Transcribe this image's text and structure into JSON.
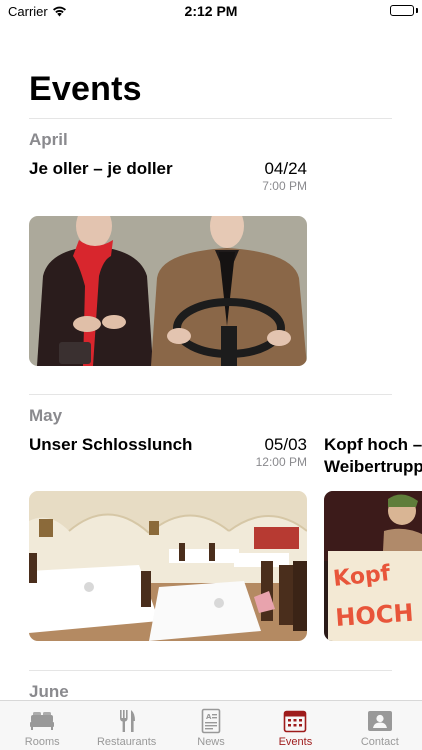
{
  "status_bar": {
    "carrier": "Carrier",
    "time": "2:12 PM",
    "battery_level": 1.0
  },
  "page": {
    "title": "Events"
  },
  "sections": [
    {
      "month": "April",
      "events": [
        {
          "title": "Je oller – je doller",
          "date": "04/24",
          "time": "7:00 PM",
          "image": "two-performers-theatre-photo"
        }
      ]
    },
    {
      "month": "May",
      "events": [
        {
          "title": "Unser Schlosslunch",
          "date": "05/03",
          "time": "12:00 PM",
          "image": "vaulted-restaurant-hall-photo"
        },
        {
          "title": "Kopf hoch – Weibertrupp",
          "title_line1": "Kopf hoch –",
          "title_line2": "Weibertrupp",
          "image": "performer-with-sign-photo",
          "sign_text_1": "Kopf",
          "sign_text_2": "HOCH"
        }
      ]
    },
    {
      "month": "June",
      "events": []
    }
  ],
  "tab_bar": {
    "active_color": "#9e1b1b",
    "inactive_color": "#999999",
    "tabs": [
      {
        "label": "Rooms",
        "icon": "bed-icon",
        "active": false
      },
      {
        "label": "Restaurants",
        "icon": "fork-knife-icon",
        "active": false
      },
      {
        "label": "News",
        "icon": "newspaper-icon",
        "active": false
      },
      {
        "label": "Events",
        "icon": "calendar-icon",
        "active": true
      },
      {
        "label": "Contact",
        "icon": "contact-card-icon",
        "active": false
      }
    ]
  }
}
